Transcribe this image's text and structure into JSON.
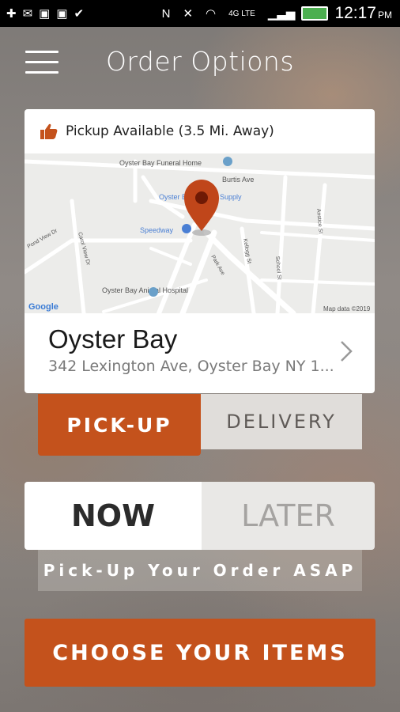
{
  "status_bar": {
    "time": "12:17",
    "ampm": "PM",
    "network": "4G LTE"
  },
  "header": {
    "title": "Order Options",
    "menu_icon": "hamburger-menu-icon"
  },
  "location_card": {
    "availability_text": "Pickup Available (3.5 Mi. Away)",
    "availability_icon": "thumbs-up-icon",
    "map": {
      "labels": {
        "funeral_home": "Oyster Bay Funeral Home",
        "burtis_ave": "Burtis Ave",
        "marine_supply": "Oyster Bay Marine Supply",
        "speedway": "Speedway",
        "pond_view": "Pond View Dr",
        "carol_view": "Carol View Dr",
        "kellogg": "Kellogg St",
        "park_ave": "Park Ave",
        "school": "School St",
        "anstice": "Anstice St",
        "hospital": "Oyster Bay Animal Hospital",
        "google": "Google",
        "attribution": "Map data ©2019"
      }
    },
    "store_name": "Oyster Bay",
    "address": "342 Lexington Ave, Oyster Bay NY 1..."
  },
  "order_type": {
    "pickup_label": "PICK-UP",
    "delivery_label": "DELIVERY",
    "selected": "PICK-UP"
  },
  "order_time": {
    "now_label": "NOW",
    "later_label": "LATER",
    "selected": "NOW",
    "note": "Pick-Up Your Order ASAP"
  },
  "cta": {
    "label": "CHOOSE YOUR ITEMS"
  },
  "colors": {
    "accent": "#c4521c",
    "marker": "#c0461a"
  }
}
